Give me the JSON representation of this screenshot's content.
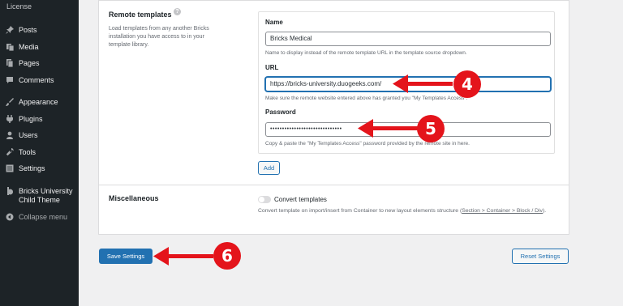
{
  "sidebar": {
    "license": "License",
    "items": [
      {
        "label": "Posts",
        "icon": "pin-icon"
      },
      {
        "label": "Media",
        "icon": "media-icon"
      },
      {
        "label": "Pages",
        "icon": "pages-icon"
      },
      {
        "label": "Comments",
        "icon": "comments-icon"
      },
      {
        "label": "Appearance",
        "icon": "brush-icon"
      },
      {
        "label": "Plugins",
        "icon": "plugin-icon"
      },
      {
        "label": "Users",
        "icon": "users-icon"
      },
      {
        "label": "Tools",
        "icon": "wrench-icon"
      },
      {
        "label": "Settings",
        "icon": "settings-icon"
      }
    ],
    "theme_line1": "Bricks University",
    "theme_line2": "Child Theme",
    "collapse": "Collapse menu"
  },
  "remote": {
    "title": "Remote templates",
    "help": "?",
    "desc_lines": [
      "Load templates from any another Bricks",
      "installation you have access to in your",
      "template library."
    ],
    "name_label": "Name",
    "name_value": "Bricks Medical",
    "name_help": "Name to display instead of the remote template URL in the template source dropdown.",
    "url_label": "URL",
    "url_value": "https://bricks-university.duogeeks.com/",
    "url_help": "Make sure the remote website entered above has granted you \"My Templates Access\".",
    "password_label": "Password",
    "password_value": "••••••••••••••••••••••••••••••",
    "password_help": "Copy & paste the \"My Templates Access\" password provided by the remote site in here.",
    "add_label": "Add"
  },
  "misc": {
    "title": "Miscellaneous",
    "toggle_label": "Convert templates",
    "toggle_on": false,
    "desc_prefix": "Convert template on import/insert from Container to new layout elements structure (",
    "desc_link": "Section > Container > Block / Div",
    "desc_suffix": ")."
  },
  "buttons": {
    "save": "Save Settings",
    "reset": "Reset Settings"
  },
  "callouts": {
    "four": "4",
    "five": "5",
    "six": "6",
    "color": "#e4141b"
  }
}
